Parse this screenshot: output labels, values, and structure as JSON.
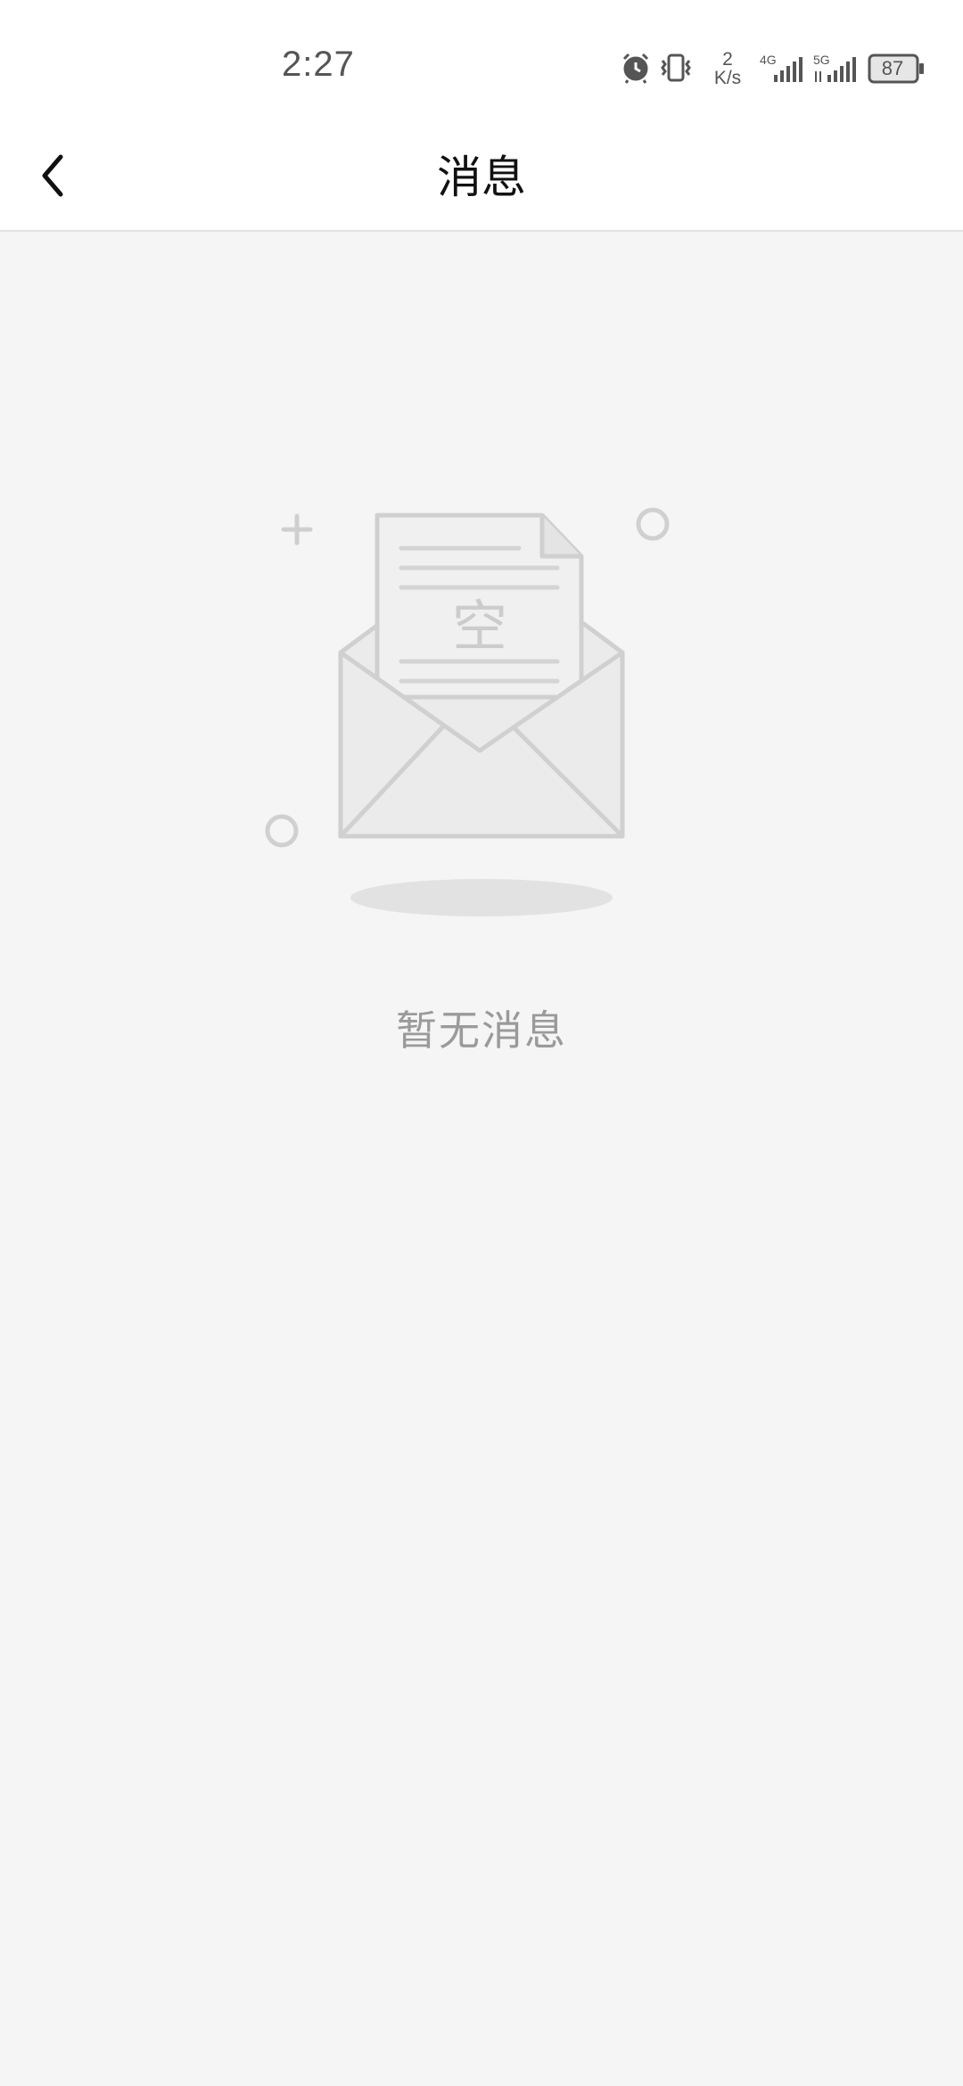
{
  "status_bar": {
    "time": "2:27",
    "net_speed_value": "2",
    "net_speed_unit": "K/s",
    "network_1": "4G",
    "network_2": "5G",
    "battery": "87",
    "icons": [
      "alarm-icon",
      "vibrate-icon",
      "signal-4g-icon",
      "signal-5g-icon",
      "battery-icon"
    ]
  },
  "header": {
    "title": "消息",
    "back_icon": "chevron-left-icon"
  },
  "empty_state": {
    "paper_text": "空",
    "message": "暂无消息",
    "icon": "empty-mailbox-illustration"
  },
  "colors": {
    "background": "#f5f5f5",
    "header_bg": "#ffffff",
    "illustration_stroke": "#d0d0d0",
    "empty_text": "#9a9a9a"
  }
}
